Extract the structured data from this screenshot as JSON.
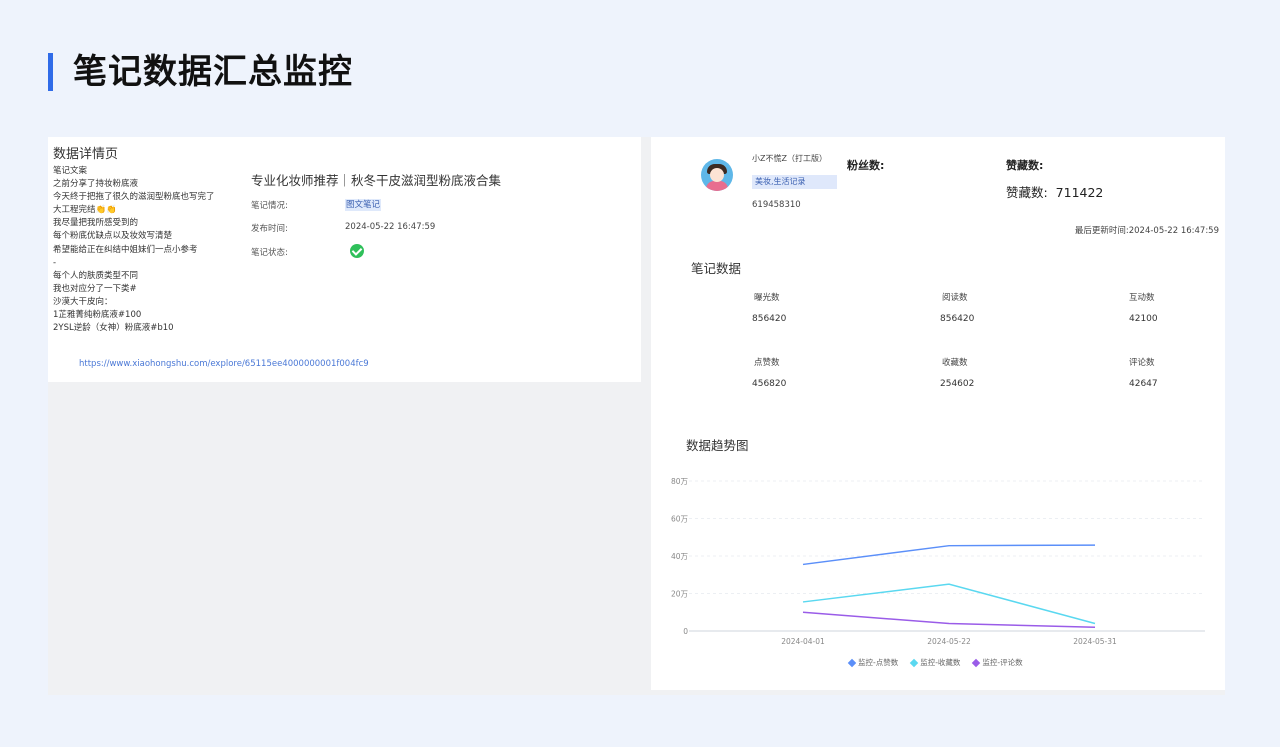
{
  "page": {
    "title": "笔记数据汇总监控"
  },
  "detail": {
    "title": "数据详情页",
    "content_lines": [
      "笔记文案",
      "之前分享了持妆粉底液",
      "今天终于把拖了很久的滋润型粉底也写完了",
      "大工程完结👏👏",
      "我尽量把我所感受到的",
      "每个粉底优缺点以及妆效写清楚",
      "希望能给正在纠结中姐妹们一点小参考",
      "-",
      "每个人的肤质类型不同",
      "我也对应分了一下类#",
      "沙漠大干皮向：",
      "1芷雅菁纯粉底液#100",
      "2YSL逆龄（女神）粉底液#b10"
    ],
    "headline": "专业化妆师推荐｜秋冬干皮滋润型粉底液合集",
    "situation_label": "笔记情况:",
    "situation_value": "图文笔记",
    "publish_label": "发布时间:",
    "publish_value": "2024-05-22 16:47:59",
    "status_label": "笔记状态:",
    "link": "https://www.xiaohongshu.com/explore/65115ee4000000001f004fc9"
  },
  "profile": {
    "name": "小Z不慌Z（打工版）",
    "tags": "美妆,生活记录",
    "id": "619458310",
    "fans_label": "粉丝数:",
    "likes_label": "赞藏数:",
    "likes_total_label": "赞藏数:",
    "likes_total_value": "711422",
    "updated_label": "最后更新时间:",
    "updated_value": "2024-05-22 16:47:59"
  },
  "stats": {
    "title": "笔记数据",
    "items": [
      {
        "label": "曝光数",
        "value": "856420"
      },
      {
        "label": "阅读数",
        "value": "856420"
      },
      {
        "label": "互动数",
        "value": "42100"
      },
      {
        "label": "点赞数",
        "value": "456820"
      },
      {
        "label": "收藏数",
        "value": "254602"
      },
      {
        "label": "评论数",
        "value": "42647"
      }
    ]
  },
  "trend": {
    "title": "数据趋势图"
  },
  "chart_data": {
    "type": "line",
    "x": [
      "2024-04-01",
      "2024-05-22",
      "2024-05-31"
    ],
    "y_ticks": [
      "0",
      "20万",
      "40万",
      "60万",
      "80万"
    ],
    "ylim": [
      0,
      80
    ],
    "grid": true,
    "legend_position": "bottom",
    "series": [
      {
        "name": "监控-点赞数",
        "values": [
          35.5,
          45.5,
          45.8
        ],
        "color": "#5b8ff9"
      },
      {
        "name": "监控-收藏数",
        "values": [
          15.5,
          25,
          4
        ],
        "color": "#5ad8f0"
      },
      {
        "name": "监控-评论数",
        "values": [
          10,
          4,
          2
        ],
        "color": "#9a5ce8"
      }
    ]
  }
}
